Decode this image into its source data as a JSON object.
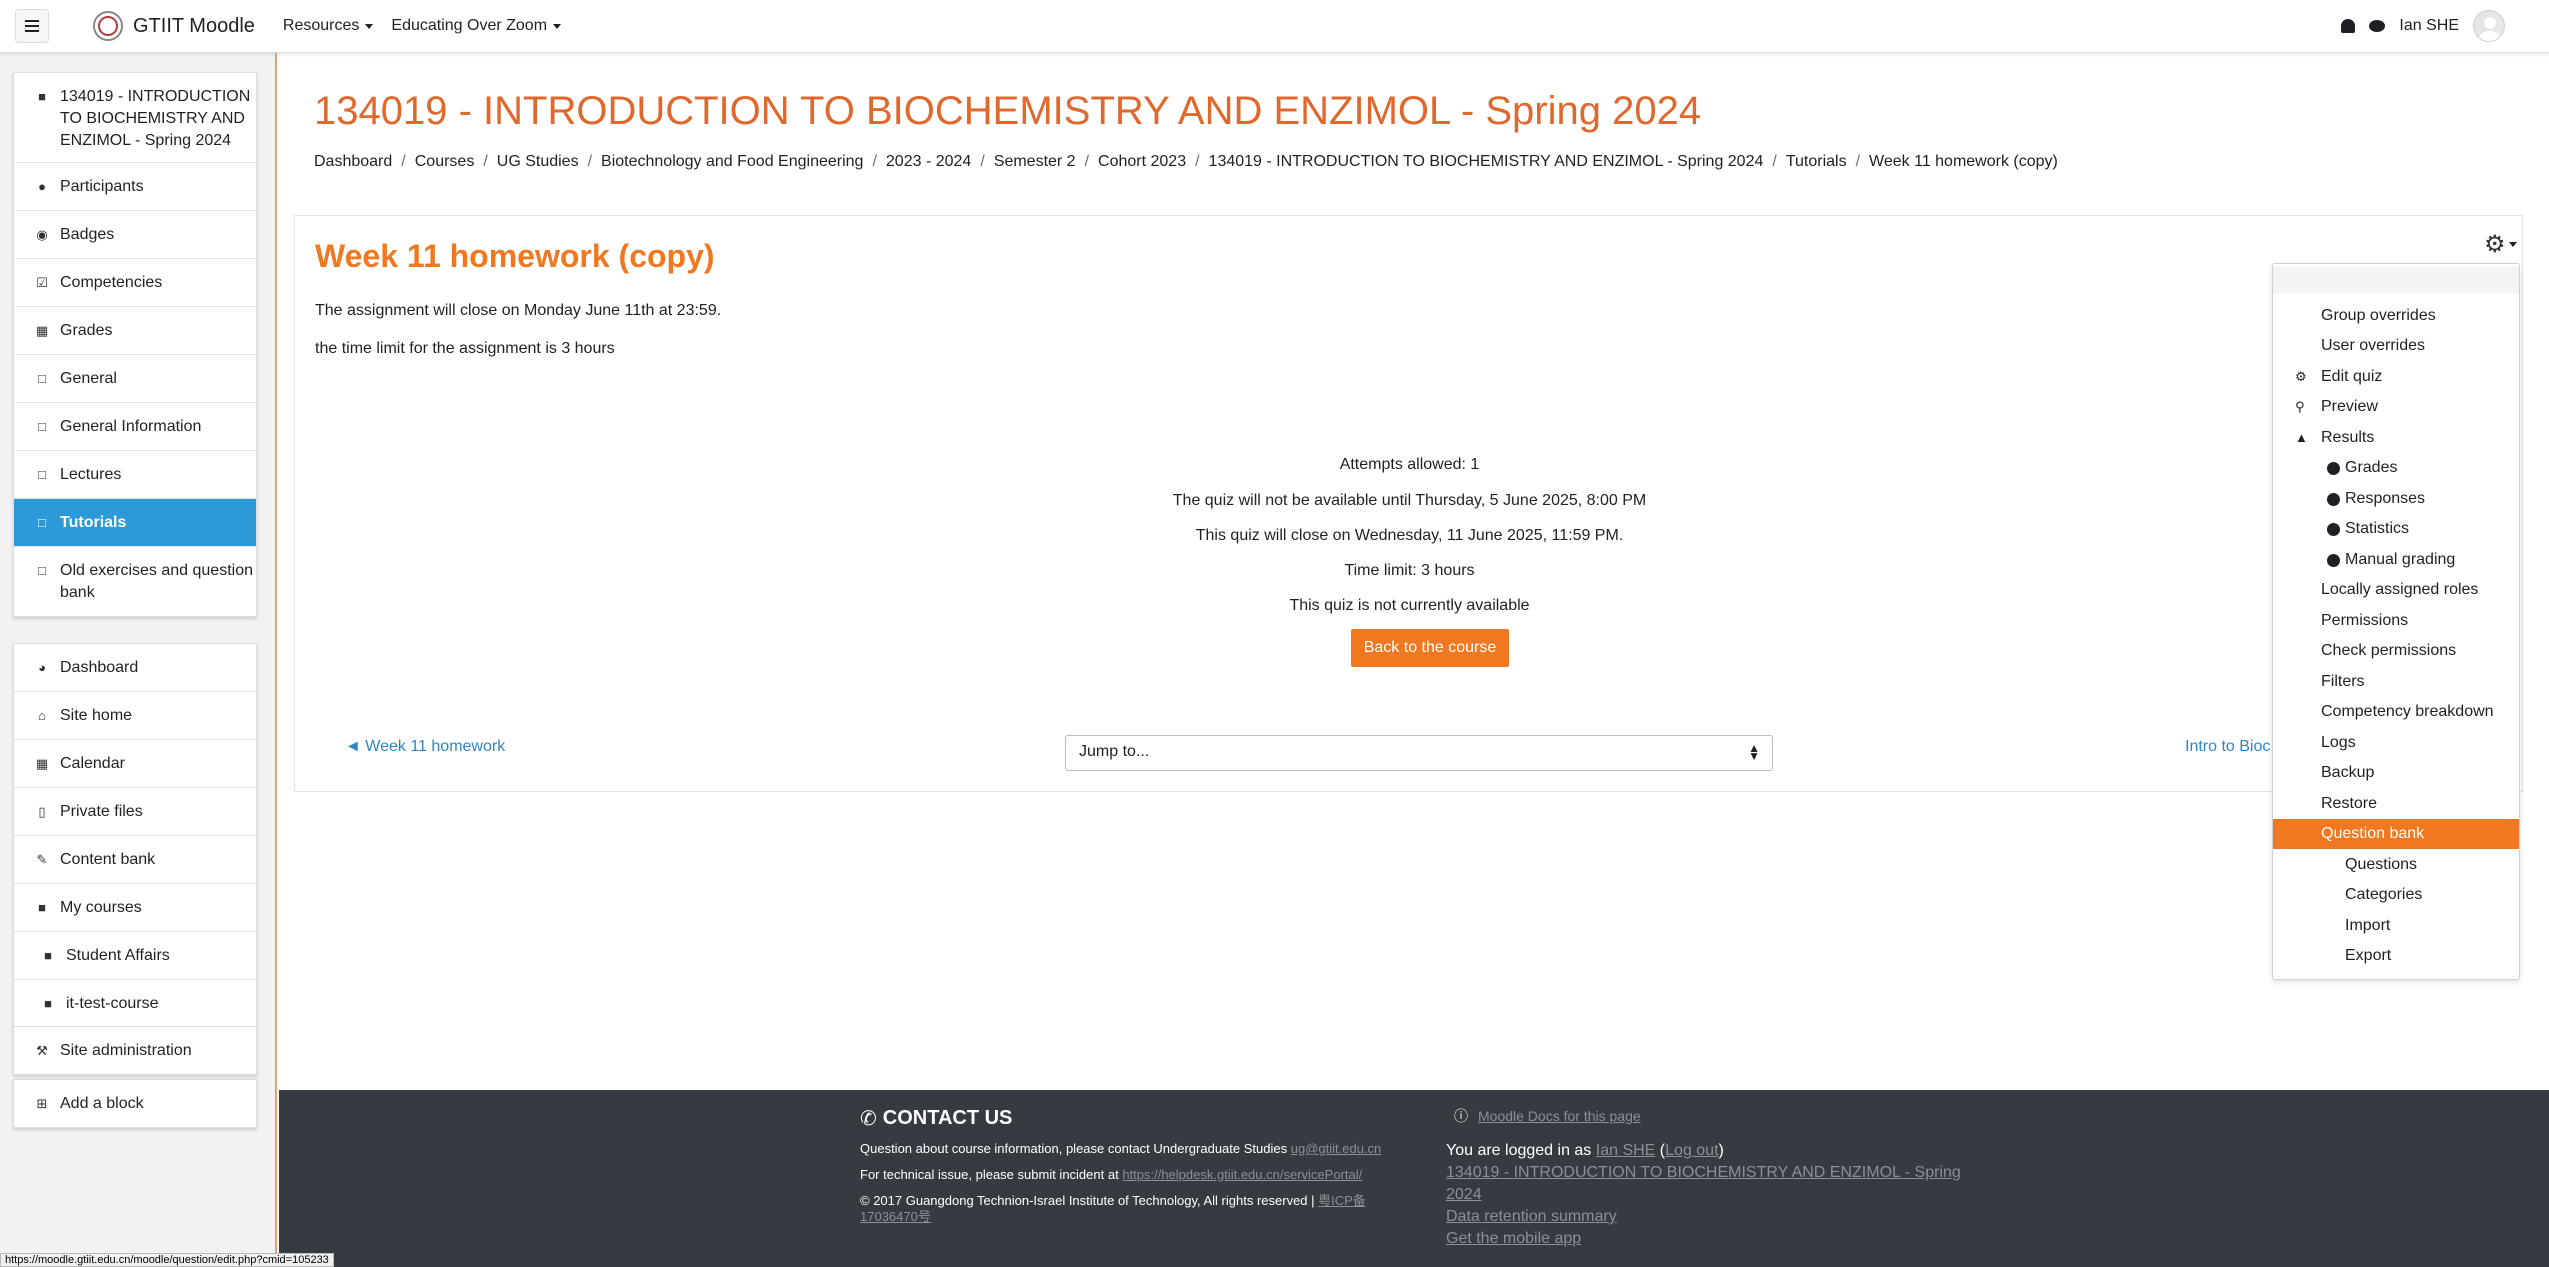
{
  "app": {
    "brand": "GTIIT Moodle",
    "nav_menu": [
      "Resources",
      "Educating Over Zoom"
    ],
    "user_name": "Ian SHE"
  },
  "sidebar": {
    "course": "134019 - INTRODUCTION TO BIOCHEMISTRY AND ENZIMOL - Spring 2024",
    "course_items": [
      {
        "label": "Participants",
        "icon": "users-icon"
      },
      {
        "label": "Badges",
        "icon": "badge-icon"
      },
      {
        "label": "Competencies",
        "icon": "check-square-icon"
      },
      {
        "label": "Grades",
        "icon": "table-icon"
      },
      {
        "label": "General",
        "icon": "folder-icon"
      },
      {
        "label": "General Information",
        "icon": "folder-icon"
      },
      {
        "label": "Lectures",
        "icon": "folder-icon"
      },
      {
        "label": "Tutorials",
        "icon": "folder-icon",
        "active": true
      },
      {
        "label": "Old exercises and question bank",
        "icon": "folder-icon"
      }
    ],
    "site_items": [
      {
        "label": "Dashboard",
        "icon": "dashboard-icon"
      },
      {
        "label": "Site home",
        "icon": "home-icon"
      },
      {
        "label": "Calendar",
        "icon": "calendar-icon"
      },
      {
        "label": "Private files",
        "icon": "file-icon"
      },
      {
        "label": "Content bank",
        "icon": "brush-icon"
      },
      {
        "label": "My courses",
        "icon": "graduation-cap-icon"
      },
      {
        "label": "Student Affairs",
        "icon": "graduation-cap-icon"
      },
      {
        "label": "it-test-course",
        "icon": "graduation-cap-icon"
      }
    ],
    "admin": "Site administration",
    "add_block": "Add a block"
  },
  "page": {
    "title": "134019 - INTRODUCTION TO BIOCHEMISTRY AND ENZIMOL - Spring 2024",
    "breadcrumb": [
      "Dashboard",
      "Courses",
      "UG Studies",
      "Biotechnology and Food Engineering",
      "2023 - 2024",
      "Semester 2",
      "Cohort 2023",
      "134019 - INTRODUCTION TO BIOCHEMISTRY AND ENZIMOL - Spring 2024",
      "Tutorials",
      "Week 11 homework (copy)"
    ]
  },
  "activity": {
    "title": "Week 11 homework (copy)",
    "intro": [
      "The assignment will close on Monday June 11th at 23:59.",
      "the time limit for the assignment is 3 hours"
    ],
    "quiz_info": [
      "Attempts allowed: 1",
      "The quiz will not be available until Thursday, 5 June 2025, 8:00 PM",
      "This quiz will close on Wednesday, 11 June 2025, 11:59 PM.",
      "Time limit: 3 hours"
    ],
    "not_available": "This quiz is not currently available",
    "back_button": "Back to the course",
    "prev_link": "◄ Week 11 homework",
    "jump_placeholder": "Jump to...",
    "next_link": "Intro to Bioc"
  },
  "admin_menu": {
    "items": [
      {
        "label": "Group overrides",
        "level": 1
      },
      {
        "label": "User overrides",
        "level": 1
      },
      {
        "label": "Edit quiz",
        "level": 0,
        "icon": "cog-icon"
      },
      {
        "label": "Preview",
        "level": 0,
        "icon": "zoom-icon"
      },
      {
        "label": "Results",
        "level": 0,
        "icon": "chart-icon"
      },
      {
        "label": "Grades",
        "level": 2
      },
      {
        "label": "Responses",
        "level": 2
      },
      {
        "label": "Statistics",
        "level": 2
      },
      {
        "label": "Manual grading",
        "level": 2
      },
      {
        "label": "Locally assigned roles",
        "level": 1
      },
      {
        "label": "Permissions",
        "level": 1
      },
      {
        "label": "Check permissions",
        "level": 1
      },
      {
        "label": "Filters",
        "level": 1
      },
      {
        "label": "Competency breakdown",
        "level": 1
      },
      {
        "label": "Logs",
        "level": 1
      },
      {
        "label": "Backup",
        "level": 1
      },
      {
        "label": "Restore",
        "level": 1
      },
      {
        "label": "Question bank",
        "level": 1,
        "active": true
      },
      {
        "label": "Questions",
        "level": 3
      },
      {
        "label": "Categories",
        "level": 3
      },
      {
        "label": "Import",
        "level": 3
      },
      {
        "label": "Export",
        "level": 3
      }
    ]
  },
  "footer": {
    "contact_heading": "CONTACT US",
    "contact_line1": "Question about course information, please contact Undergraduate Studies",
    "contact_email": "ug@gtiit.edu.cn",
    "contact_line2": "For technical issue, please submit incident at",
    "contact_portal": "https://helpdesk.gtiit.edu.cn/servicePortal/",
    "copyright": "© 2017 Guangdong Technion-Israel Institute of Technology, All rights reserved |",
    "icp": "粤ICP备17036470号",
    "docs_link": "Moodle Docs for this page",
    "logged_in_prefix": "You are logged in as",
    "logged_in_user": "Ian SHE",
    "logout": "Log out",
    "course_link": "134019 - INTRODUCTION TO BIOCHEMISTRY AND ENZIMOL - Spring 2024",
    "data_retention": "Data retention summary",
    "mobile_app": "Get the mobile app"
  },
  "status_bar": {
    "url": "https://moodle.gtiit.edu.cn/moodle/question/edit.php?cmid=105233"
  },
  "colors": {
    "accent": "#f07820",
    "title": "#e0682c",
    "active_nav": "#2c9ad8",
    "link": "#2c87c8",
    "footer_bg": "#353b41"
  }
}
